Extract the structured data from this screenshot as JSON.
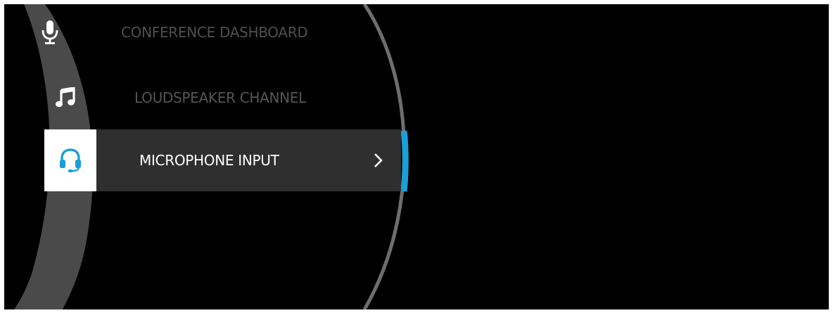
{
  "menu": {
    "items": [
      {
        "label": "CONFERENCE DASHBOARD",
        "icon": "microphone-icon",
        "selected": false
      },
      {
        "label": "LOUDSPEAKER CHANNEL",
        "icon": "music-note-icon",
        "selected": false
      },
      {
        "label": "MICROPHONE INPUT",
        "icon": "headset-icon",
        "selected": true
      }
    ]
  },
  "colors": {
    "background": "#000000",
    "ring": "#4a4a4a",
    "outer_arc": "#6e6e6e",
    "selected_row": "#2f2f2f",
    "accent": "#1a9fd8",
    "label_dim": "#4f4f4f",
    "label_active": "#ffffff"
  }
}
